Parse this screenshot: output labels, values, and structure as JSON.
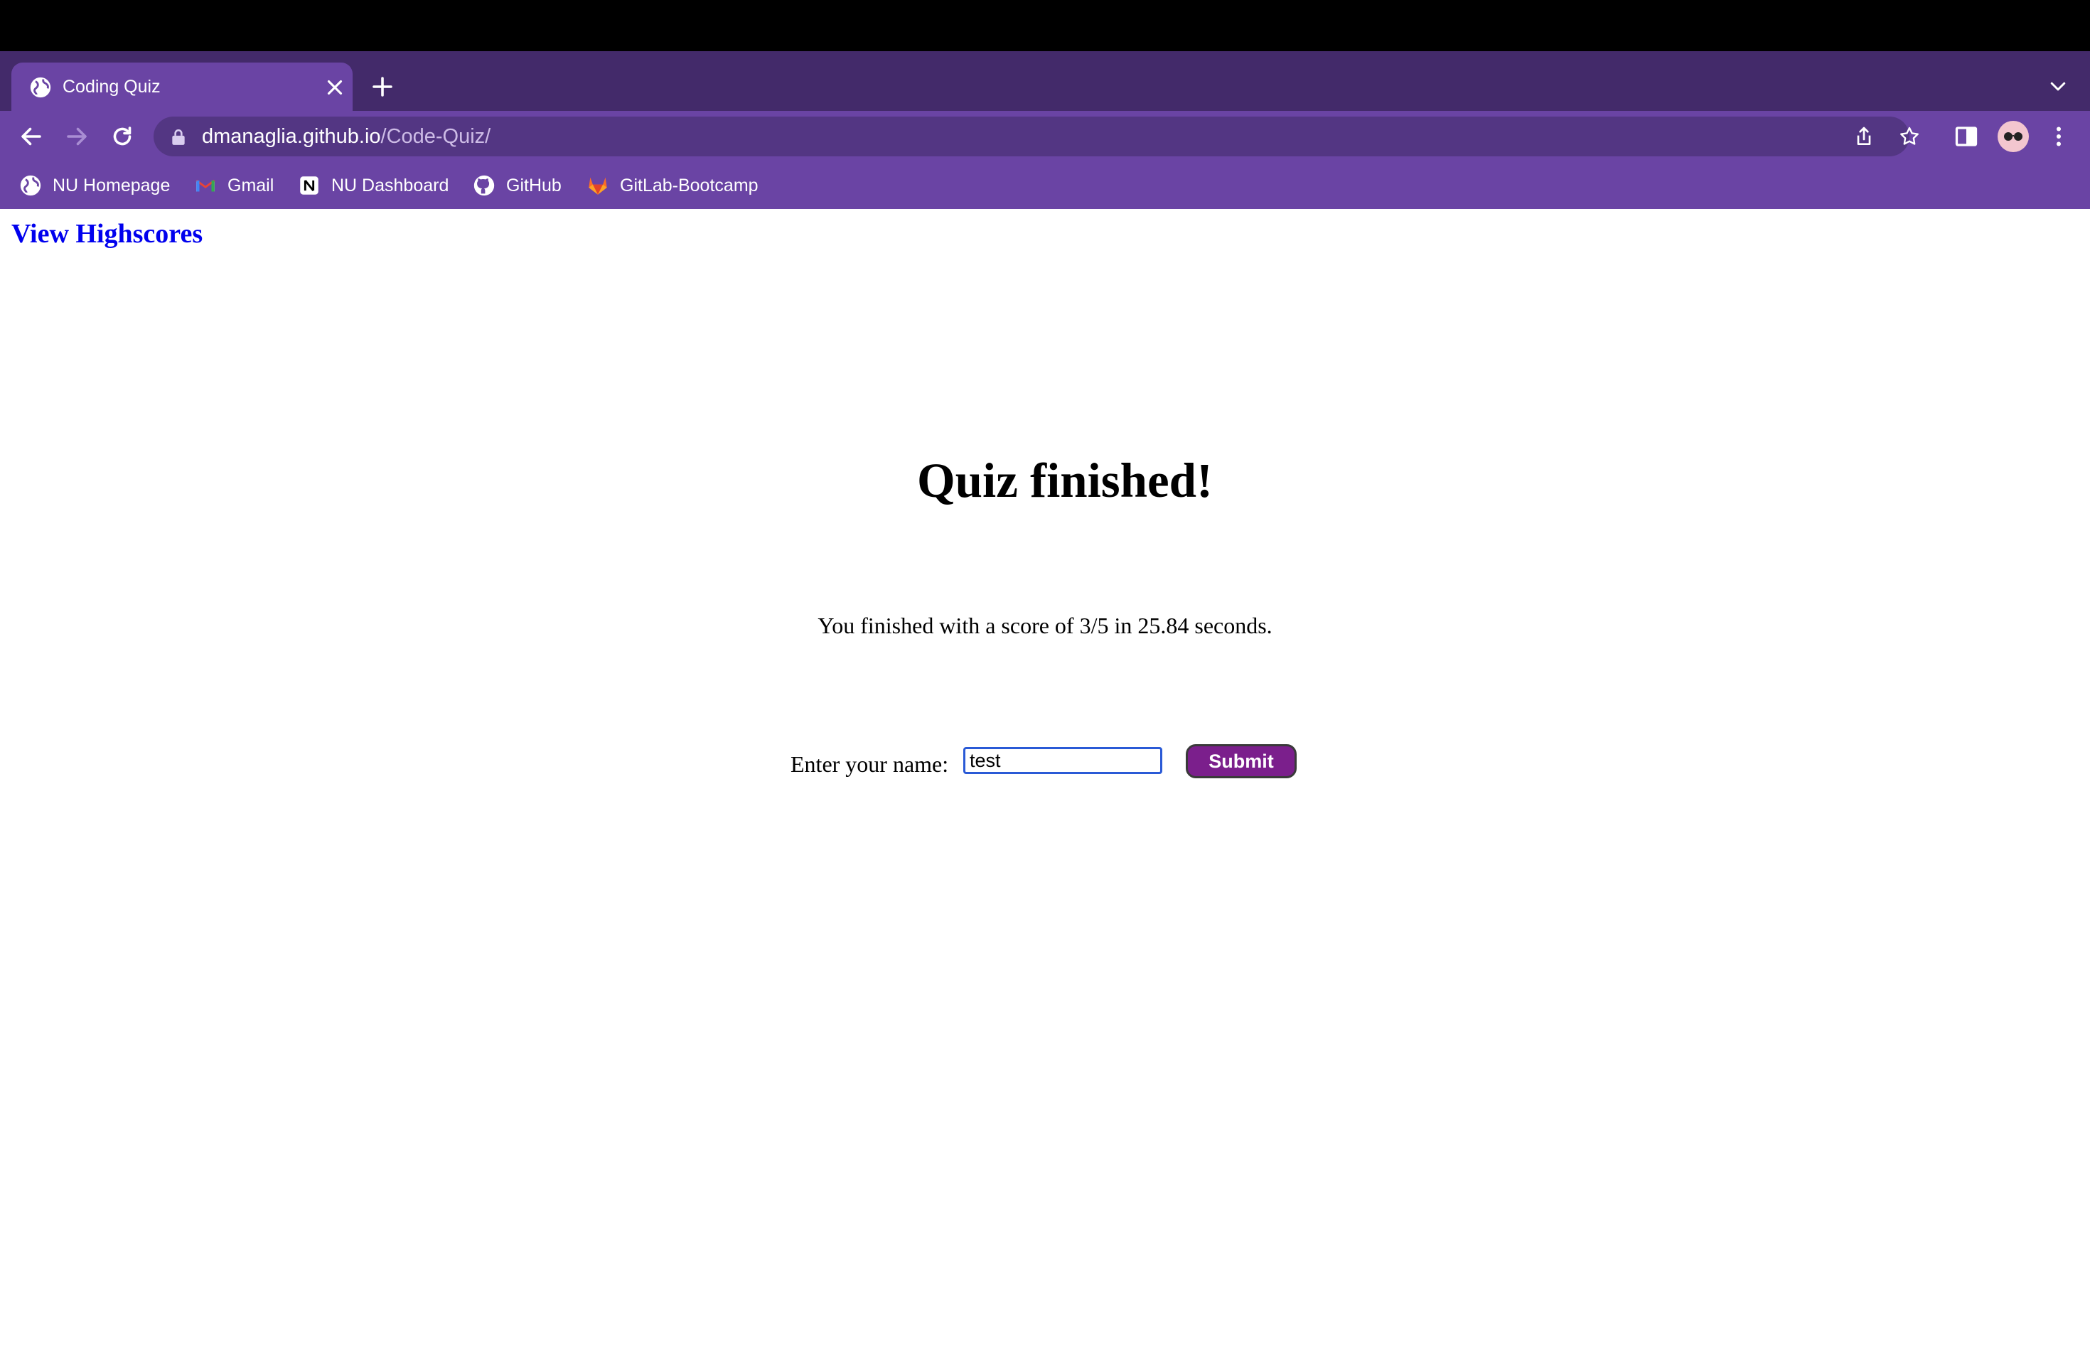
{
  "browser": {
    "tab": {
      "title": "Coding Quiz"
    },
    "address_bar": {
      "host": "dmanaglia.github.io",
      "path": "/Code-Quiz/"
    },
    "bookmarks": [
      {
        "label": "NU Homepage",
        "icon": "globe-icon"
      },
      {
        "label": "Gmail",
        "icon": "gmail-icon"
      },
      {
        "label": "NU Dashboard",
        "icon": "notion-icon"
      },
      {
        "label": "GitHub",
        "icon": "github-icon"
      },
      {
        "label": "GitLab-Bootcamp",
        "icon": "gitlab-icon"
      }
    ],
    "colors": {
      "tabstrip": "#432a6a",
      "toolbar": "#6a44a4",
      "omnibox": "#533683"
    }
  },
  "page": {
    "highscores_link": "View Highscores",
    "heading": "Quiz finished!",
    "score_text": "You finished with a score of 3/5 in 25.84 seconds.",
    "name_label": "Enter your name:",
    "name_value": "test",
    "submit_label": "Submit",
    "colors": {
      "link": "#0000ee",
      "submit_bg": "#7b1f8c",
      "input_border": "#2a5ad6"
    }
  }
}
